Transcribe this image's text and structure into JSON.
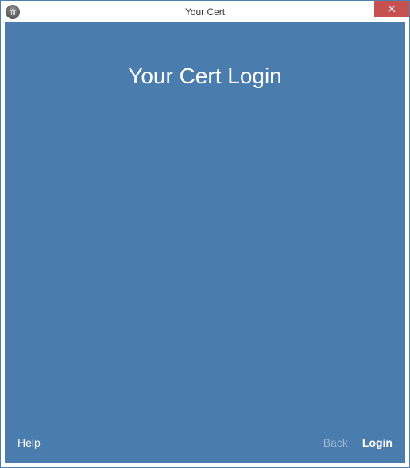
{
  "window": {
    "title": "Your Cert"
  },
  "main": {
    "heading": "Your Cert Login"
  },
  "footer": {
    "help": "Help",
    "back": "Back",
    "login": "Login"
  }
}
